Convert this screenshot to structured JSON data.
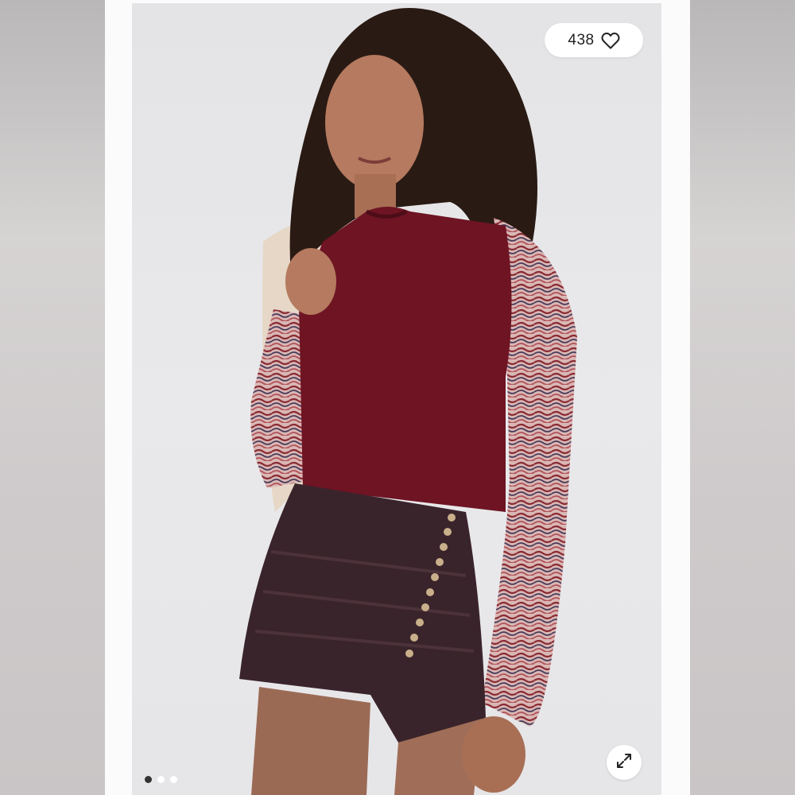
{
  "listing": {
    "likes_count": "438",
    "like_icon": "heart-icon",
    "expand_icon": "expand-icon"
  },
  "carousel": {
    "dots": [
      {
        "active": true
      },
      {
        "active": false
      },
      {
        "active": false
      }
    ]
  },
  "colors": {
    "background": "#ffffff",
    "photo_backdrop": "#e6e6e8",
    "pill_bg": "#ffffff",
    "text": "#222222",
    "top_burgundy": "#6e1423",
    "skirt_brown": "#3a242b"
  }
}
